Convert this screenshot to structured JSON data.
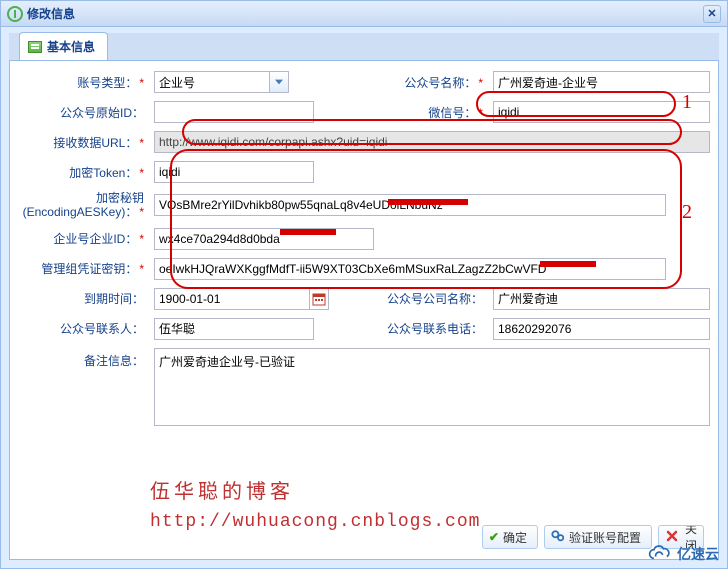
{
  "window": {
    "title": "修改信息"
  },
  "tabs": [
    {
      "label": "基本信息"
    }
  ],
  "fields": {
    "acct_type_label": "账号类型：",
    "acct_type_value": "企业号",
    "pub_name_label": "公众号名称：",
    "pub_name_value": "广州爱奇迪-企业号",
    "orig_id_label": "公众号原始ID：",
    "orig_id_value": "",
    "wechat_label": "微信号：",
    "wechat_value": "iqidi",
    "url_label": "接收数据URL：",
    "url_value": "http://www.iqidi.com/corpapi.ashx?uid=iqidi",
    "token_label": "加密Token：",
    "token_value": "iqidi",
    "aes_label": "加密秘钥\n(EncodingAESKey)：",
    "aes_value": "VOsBMre2rYilDvhikb80pw55qnaLq8v4eUDolLNbuNz",
    "corp_id_label": "企业号企业ID：",
    "corp_id_value": "wx4ce70a294d8d0bda",
    "mgmt_key_label": "管理组凭证密钥：",
    "mgmt_key_value": "oeIwkHJQraWXKggfMdfT-ii5W9XT03CbXe6mMSuxRaLZagzZ2bCwVFD",
    "expire_label": "到期时间：",
    "expire_value": "1900-01-01",
    "company_label": "公众号公司名称：",
    "company_value": "广州爱奇迪",
    "contact_label": "公众号联系人：",
    "contact_value": "伍华聪",
    "phone_label": "公众号联系电话：",
    "phone_value": "18620292076",
    "remark_label": "备注信息：",
    "remark_value": "广州爱奇迪企业号-已验证"
  },
  "buttons": {
    "ok": "确定",
    "verify": "验证账号配置",
    "cancel": "关闭"
  },
  "annotations": {
    "n1": "1",
    "n2": "2"
  },
  "watermark": {
    "line1": "伍华聪的博客",
    "line2": "http://wuhuacong.cnblogs.com"
  },
  "brand": "亿速云"
}
